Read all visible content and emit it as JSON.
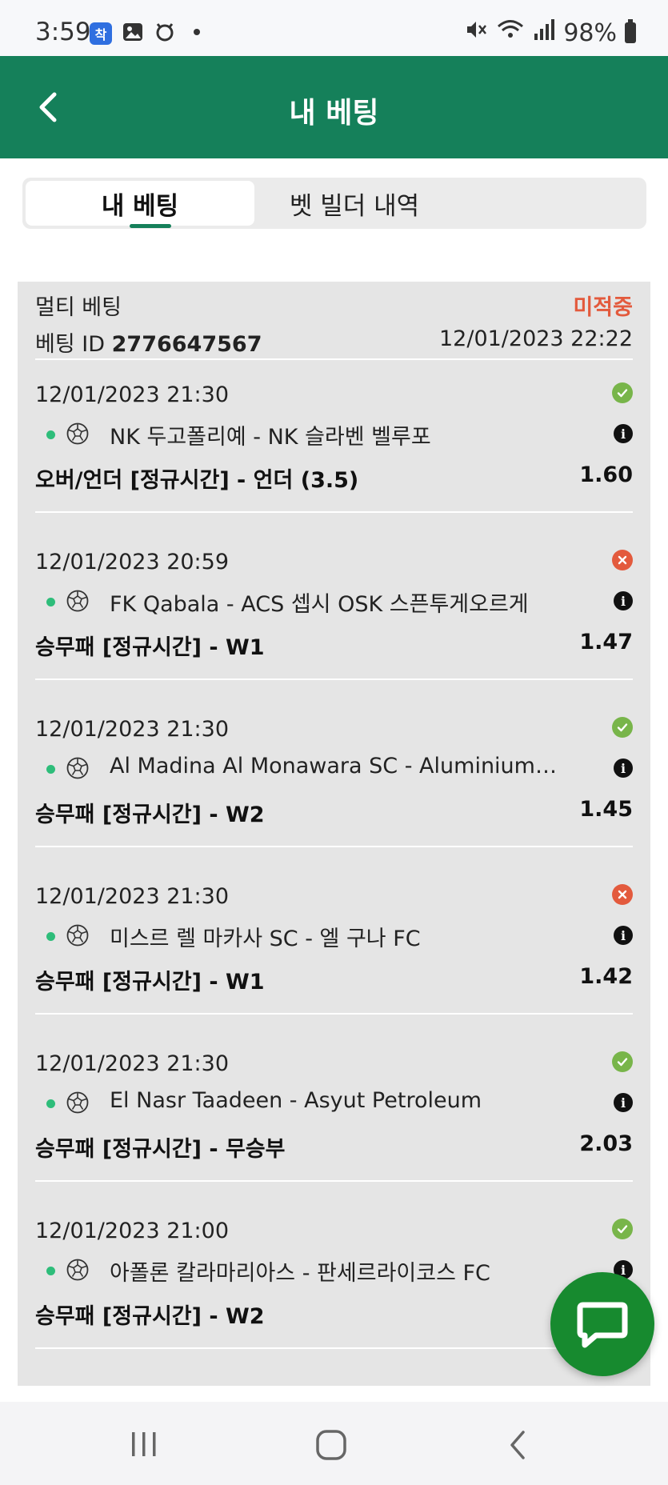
{
  "status_bar": {
    "time": "3:59",
    "battery": "98%",
    "app_icons": [
      "app-badge-icon",
      "gallery-icon",
      "cat-icon",
      "dot-icon"
    ]
  },
  "header": {
    "title": "내 베팅"
  },
  "tabs": [
    {
      "label": "내 베팅",
      "active": true
    },
    {
      "label": "벳 빌더 내역",
      "active": false
    }
  ],
  "bet": {
    "type": "멀티 베팅",
    "status": "미적중",
    "id_label": "베팅 ID",
    "id": "2776647567",
    "placed_at": "12/01/2023 22:22",
    "selections": [
      {
        "time": "12/01/2023 21:30",
        "result": "won",
        "match": "NK 두고폴리예 - NK 슬라벤 벨루포",
        "market": "오버/언더 [정규시간] - 언더 (3.5)",
        "odds": "1.60"
      },
      {
        "time": "12/01/2023 20:59",
        "result": "lost",
        "match": "FK Qabala - ACS 셉시 OSK 스픈투게오르게",
        "market": "승무패 [정규시간] - W1",
        "odds": "1.47"
      },
      {
        "time": "12/01/2023 21:30",
        "result": "won",
        "match": "Al Madina Al Monawara SC - Aluminium Na...",
        "market": "승무패 [정규시간] - W2",
        "odds": "1.45"
      },
      {
        "time": "12/01/2023 21:30",
        "result": "lost",
        "match": "미스르 렐 마카사 SC - 엘 구나 FC",
        "market": "승무패 [정규시간] - W1",
        "odds": "1.42"
      },
      {
        "time": "12/01/2023 21:30",
        "result": "won",
        "match": "El Nasr Taadeen - Asyut Petroleum",
        "market": "승무패 [정규시간] - 무승부",
        "odds": "2.03"
      },
      {
        "time": "12/01/2023 21:00",
        "result": "won",
        "match": "아폴론 칼라마리아스 - 판세르라이코스 FC",
        "market": "승무패 [정규시간] - W2",
        "odds": ""
      }
    ]
  },
  "colors": {
    "brand_green": "#15805a",
    "won": "#78b54a",
    "lost": "#e35a3d",
    "live_dot": "#2ebd7a",
    "chat_fab": "#178a2f"
  }
}
